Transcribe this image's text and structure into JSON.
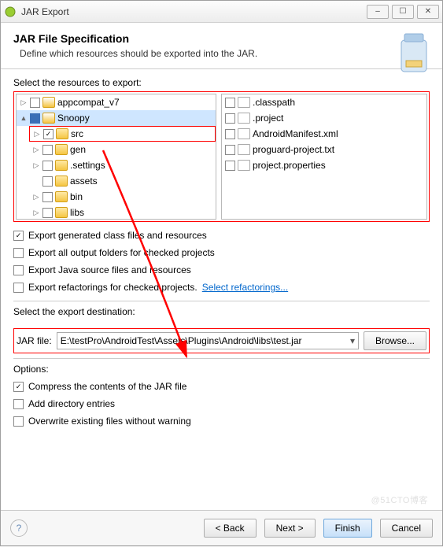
{
  "window": {
    "title": "JAR Export"
  },
  "banner": {
    "heading": "JAR File Specification",
    "sub": "Define which resources should be exported into the JAR."
  },
  "resources_label": "Select the resources to export:",
  "tree": [
    {
      "exp": "▷",
      "chk": "",
      "icon": "folder-b",
      "label": "appcompat_v7",
      "indent": 0
    },
    {
      "exp": "▲",
      "chk": "filled",
      "icon": "folder-b",
      "label": "Snoopy",
      "indent": 0,
      "selected": true
    },
    {
      "exp": "▷",
      "chk": "checked",
      "icon": "folder-y",
      "label": "src",
      "indent": 1,
      "hl": true
    },
    {
      "exp": "▷",
      "chk": "",
      "icon": "folder-y",
      "label": "gen",
      "indent": 1
    },
    {
      "exp": "▷",
      "chk": "",
      "icon": "folder-y",
      "label": ".settings",
      "indent": 1
    },
    {
      "exp": "",
      "chk": "",
      "icon": "folder-y",
      "label": "assets",
      "indent": 1
    },
    {
      "exp": "▷",
      "chk": "",
      "icon": "folder-y",
      "label": "bin",
      "indent": 1
    },
    {
      "exp": "▷",
      "chk": "",
      "icon": "folder-y",
      "label": "libs",
      "indent": 1
    }
  ],
  "files": [
    {
      "chk": "",
      "icon": "folder-p",
      "label": ".classpath"
    },
    {
      "chk": "",
      "icon": "folder-p",
      "label": ".project"
    },
    {
      "chk": "",
      "icon": "folder-p",
      "label": "AndroidManifest.xml"
    },
    {
      "chk": "",
      "icon": "folder-p",
      "label": "proguard-project.txt"
    },
    {
      "chk": "",
      "icon": "folder-p",
      "label": "project.properties"
    }
  ],
  "checks": {
    "c1": {
      "checked": true,
      "label": "Export generated class files and resources"
    },
    "c2": {
      "checked": false,
      "label": "Export all output folders for checked projects"
    },
    "c3": {
      "checked": false,
      "label": "Export Java source files and resources"
    },
    "c4": {
      "checked": false,
      "label": "Export refactorings for checked projects.",
      "link": "Select refactorings..."
    }
  },
  "dest_label": "Select the export destination:",
  "jar_label": "JAR file:",
  "jar_path": "E:\\testPro\\AndroidTest\\Assets\\Plugins\\Android\\libs\\test.jar",
  "browse": "Browse...",
  "options_label": "Options:",
  "opts": {
    "o1": {
      "checked": true,
      "label": "Compress the contents of the JAR file"
    },
    "o2": {
      "checked": false,
      "label": "Add directory entries"
    },
    "o3": {
      "checked": false,
      "label": "Overwrite existing files without warning"
    }
  },
  "buttons": {
    "back": "< Back",
    "next": "Next >",
    "finish": "Finish",
    "cancel": "Cancel"
  },
  "watermark": "@51CTO博客"
}
